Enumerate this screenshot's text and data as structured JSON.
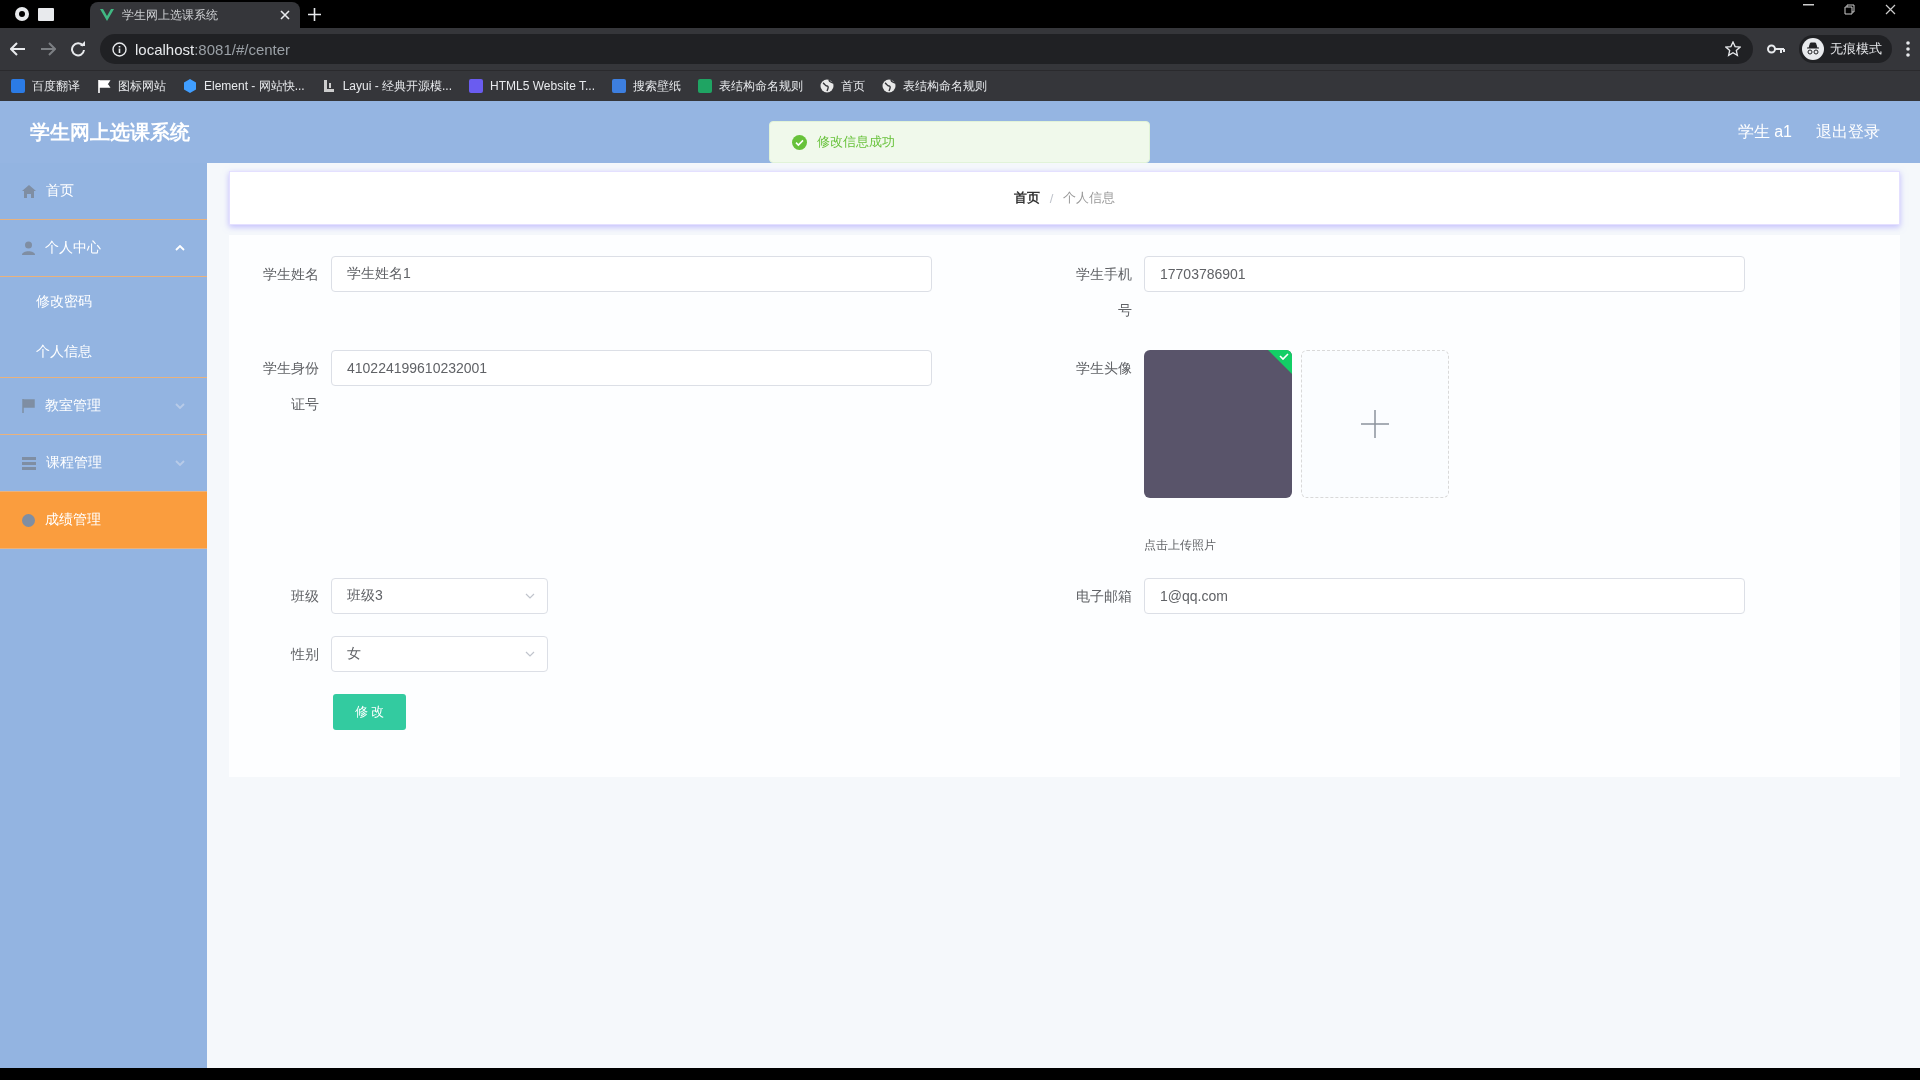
{
  "browser": {
    "tab": {
      "title": "学生网上选课系统"
    },
    "address": "**localhost**:8081/#/center",
    "incognito_label": "无痕模式",
    "bookmarks": [
      {
        "label": "百度翻译",
        "kind": "tile",
        "color": "#2b7be5"
      },
      {
        "label": "图标网站",
        "kind": "flag",
        "color": "#ffffff"
      },
      {
        "label": "Element - 网站快...",
        "kind": "hexagon",
        "color": "#409eff"
      },
      {
        "label": "Layui - 经典开源模...",
        "kind": "mark",
        "color": "#cccccc"
      },
      {
        "label": "HTML5 Website T...",
        "kind": "tile",
        "color": "#6a5cf0"
      },
      {
        "label": "搜索壁纸",
        "kind": "tile",
        "color": "#3d7fe0"
      },
      {
        "label": "表结构命名规则",
        "kind": "tile",
        "color": "#1fa463"
      },
      {
        "label": "首页",
        "kind": "globe",
        "color": "#e8e8e8"
      },
      {
        "label": "表结构命名规则",
        "kind": "globe",
        "color": "#e8e8e8"
      }
    ]
  },
  "header": {
    "title": "学生网上选课系统",
    "user": "学生 a1",
    "logout": "退出登录"
  },
  "toast": {
    "text": "修改信息成功"
  },
  "sidebar": {
    "items": [
      {
        "label": "首页",
        "kind": "home",
        "selected": false
      },
      {
        "label": "个人中心",
        "kind": "user",
        "selected": false,
        "expanded": true,
        "children": [
          {
            "label": "修改密码",
            "selected": false
          },
          {
            "label": "个人信息",
            "selected": false
          }
        ]
      },
      {
        "label": "教室管理",
        "kind": "flag",
        "selected": false,
        "expanded": false
      },
      {
        "label": "课程管理",
        "kind": "stack",
        "selected": false,
        "expanded": false
      },
      {
        "label": "成绩管理",
        "kind": "circle",
        "selected": true
      }
    ]
  },
  "breadcrumb": {
    "separator": "/",
    "items": [
      {
        "label": "首页",
        "current": false
      },
      {
        "label": "个人信息",
        "current": true
      }
    ]
  },
  "form": {
    "left": [
      {
        "label": "学生姓名",
        "kind": "input",
        "value": "学生姓名1"
      },
      {
        "label": "学生身份证号",
        "kind": "input",
        "value": "410224199610232001"
      },
      {
        "label": "班级",
        "kind": "select",
        "value": "班级3"
      },
      {
        "label": "性别",
        "kind": "select",
        "value": "女"
      }
    ],
    "right": [
      {
        "label": "学生手机号",
        "kind": "input",
        "value": "17703786901"
      },
      {
        "label": "学生头像",
        "kind": "upload",
        "uploaded": true,
        "hint": "点击上传照片"
      },
      {
        "label": "电子邮箱",
        "kind": "input",
        "value": "1@qq.com"
      }
    ],
    "submit": "修 改"
  }
}
